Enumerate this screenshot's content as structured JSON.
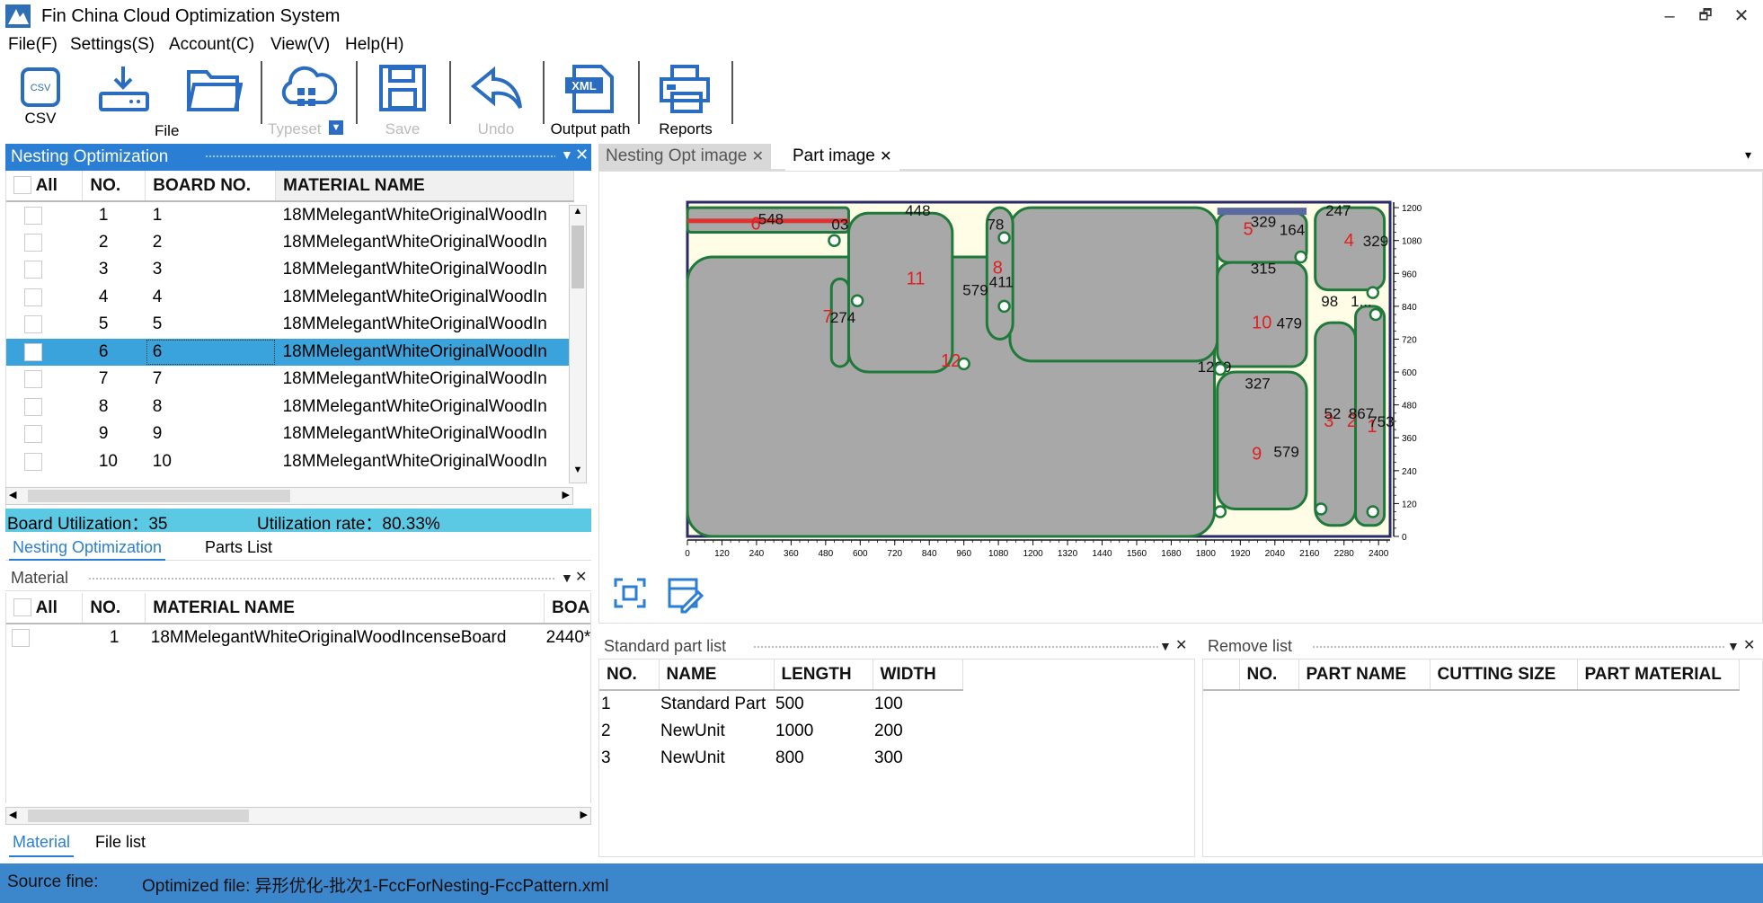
{
  "window": {
    "title": "Fin China Cloud Optimization System",
    "controls": [
      "–",
      "🗗",
      "✕"
    ]
  },
  "menu": [
    "File(F)",
    "Settings(S)",
    "Account(C)",
    "View(V)",
    "Help(H)"
  ],
  "toolbar": {
    "csv": "CSV",
    "file": "File",
    "typeset": "Typeset",
    "save": "Save",
    "undo": "Undo",
    "output_path": "Output path",
    "reports": "Reports"
  },
  "nesting_panel": {
    "title": "Nesting Optimization",
    "columns": [
      "All",
      "NO.",
      "BOARD NO.",
      "MATERIAL NAME"
    ],
    "rows": [
      {
        "no": "1",
        "board": "1",
        "material": "18MMelegantWhiteOriginalWoodIn"
      },
      {
        "no": "2",
        "board": "2",
        "material": "18MMelegantWhiteOriginalWoodIn"
      },
      {
        "no": "3",
        "board": "3",
        "material": "18MMelegantWhiteOriginalWoodIn"
      },
      {
        "no": "4",
        "board": "4",
        "material": "18MMelegantWhiteOriginalWoodIn"
      },
      {
        "no": "5",
        "board": "5",
        "material": "18MMelegantWhiteOriginalWoodIn"
      },
      {
        "no": "6",
        "board": "6",
        "material": "18MMelegantWhiteOriginalWoodIn"
      },
      {
        "no": "7",
        "board": "7",
        "material": "18MMelegantWhiteOriginalWoodIn"
      },
      {
        "no": "8",
        "board": "8",
        "material": "18MMelegantWhiteOriginalWoodIn"
      },
      {
        "no": "9",
        "board": "9",
        "material": "18MMelegantWhiteOriginalWoodIn"
      },
      {
        "no": "10",
        "board": "10",
        "material": "18MMelegantWhiteOriginalWoodIn"
      }
    ],
    "selected_row": 5,
    "board_utilization": "Board Utilization：35",
    "utilization_rate": "Utilization rate：80.33%",
    "tabs": [
      "Nesting Optimization",
      "Parts List"
    ]
  },
  "material_panel": {
    "title": "Material",
    "columns": [
      "All",
      "NO.",
      "MATERIAL NAME",
      "BOA"
    ],
    "rows": [
      {
        "no": "1",
        "material": "18MMelegantWhiteOriginalWoodIncenseBoard",
        "board": "2440*"
      }
    ],
    "tabs": [
      "Material",
      "File list"
    ]
  },
  "doc_tabs": [
    "Nesting Opt image",
    "Part image"
  ],
  "viewer": {
    "x_ticks": [
      "0",
      "120",
      "240",
      "360",
      "480",
      "600",
      "720",
      "840",
      "960",
      "1080",
      "1200",
      "1320",
      "1440",
      "1560",
      "1680",
      "1800",
      "1920",
      "2040",
      "2160",
      "2280",
      "2400"
    ],
    "y_ticks": [
      "1200",
      "1080",
      "960",
      "840",
      "720",
      "600",
      "480",
      "360",
      "240",
      "120",
      "0"
    ],
    "part_ids": [
      "6",
      "7",
      "11",
      "8",
      "12",
      "5",
      "4",
      "10",
      "3",
      "2",
      "1",
      "9"
    ],
    "dim_labels": [
      "548",
      "03",
      "448",
      "78",
      "329",
      "247",
      "164",
      "329",
      "274",
      "579",
      "411",
      "315",
      "98",
      "1...",
      "479",
      "1209",
      "327",
      "52",
      "867",
      "753",
      "579"
    ]
  },
  "standard_parts": {
    "title": "Standard part list",
    "columns": [
      "NO.",
      "NAME",
      "LENGTH",
      "WIDTH"
    ],
    "rows": [
      {
        "no": "1",
        "name": "Standard Part",
        "length": "500",
        "width": "100"
      },
      {
        "no": "2",
        "name": "NewUnit",
        "length": "1000",
        "width": "200"
      },
      {
        "no": "3",
        "name": "NewUnit",
        "length": "800",
        "width": "300"
      }
    ]
  },
  "remove_list": {
    "title": "Remove list",
    "columns": [
      "NO.",
      "PART NAME",
      "CUTTING SIZE",
      "PART MATERIAL"
    ]
  },
  "status": {
    "source": "Source fine:",
    "optimized": "Optimized file: 异形优化-批次1-FccForNesting-FccPattern.xml"
  }
}
